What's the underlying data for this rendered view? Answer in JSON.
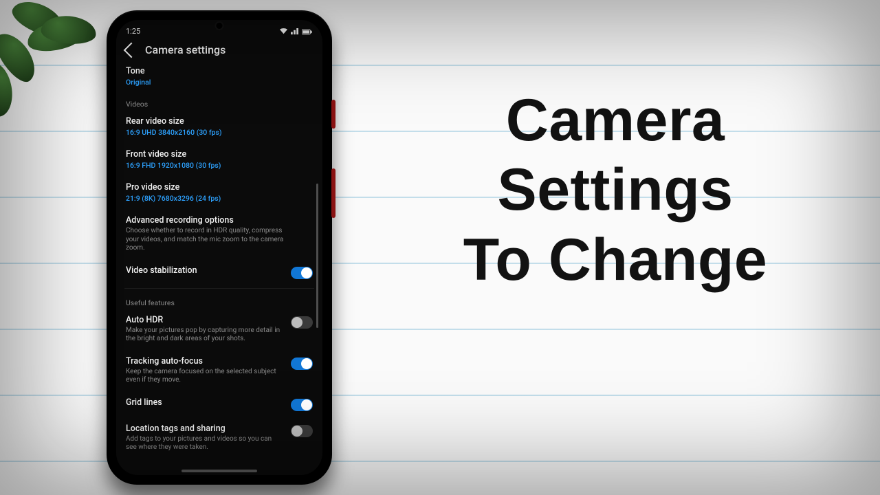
{
  "title_lines": [
    "Camera",
    "Settings",
    "To Change"
  ],
  "statusbar": {
    "time": "1:25"
  },
  "header": {
    "title": "Camera settings"
  },
  "rows": {
    "tone": {
      "title": "Tone",
      "value": "Original"
    },
    "rear_video": {
      "title": "Rear video size",
      "value": "16:9 UHD 3840x2160 (30 fps)"
    },
    "front_video": {
      "title": "Front video size",
      "value": "16:9 FHD 1920x1080 (30 fps)"
    },
    "pro_video": {
      "title": "Pro video size",
      "value": "21:9 (8K) 7680x3296 (24 fps)"
    },
    "adv_rec": {
      "title": "Advanced recording options",
      "desc": "Choose whether to record in HDR quality, compress your videos, and match the mic zoom to the camera zoom."
    },
    "stabilization": {
      "title": "Video stabilization",
      "on": true
    },
    "auto_hdr": {
      "title": "Auto HDR",
      "desc": "Make your pictures pop by capturing more detail in the bright and dark areas of your shots.",
      "on": false
    },
    "track_af": {
      "title": "Tracking auto-focus",
      "desc": "Keep the camera focused on the selected subject even if they move.",
      "on": true
    },
    "grid": {
      "title": "Grid lines",
      "on": true
    },
    "location": {
      "title": "Location tags and sharing",
      "desc": "Add tags to your pictures and videos so you can see where they were taken.",
      "on": false
    }
  },
  "sections": {
    "videos": "Videos",
    "useful": "Useful features"
  }
}
